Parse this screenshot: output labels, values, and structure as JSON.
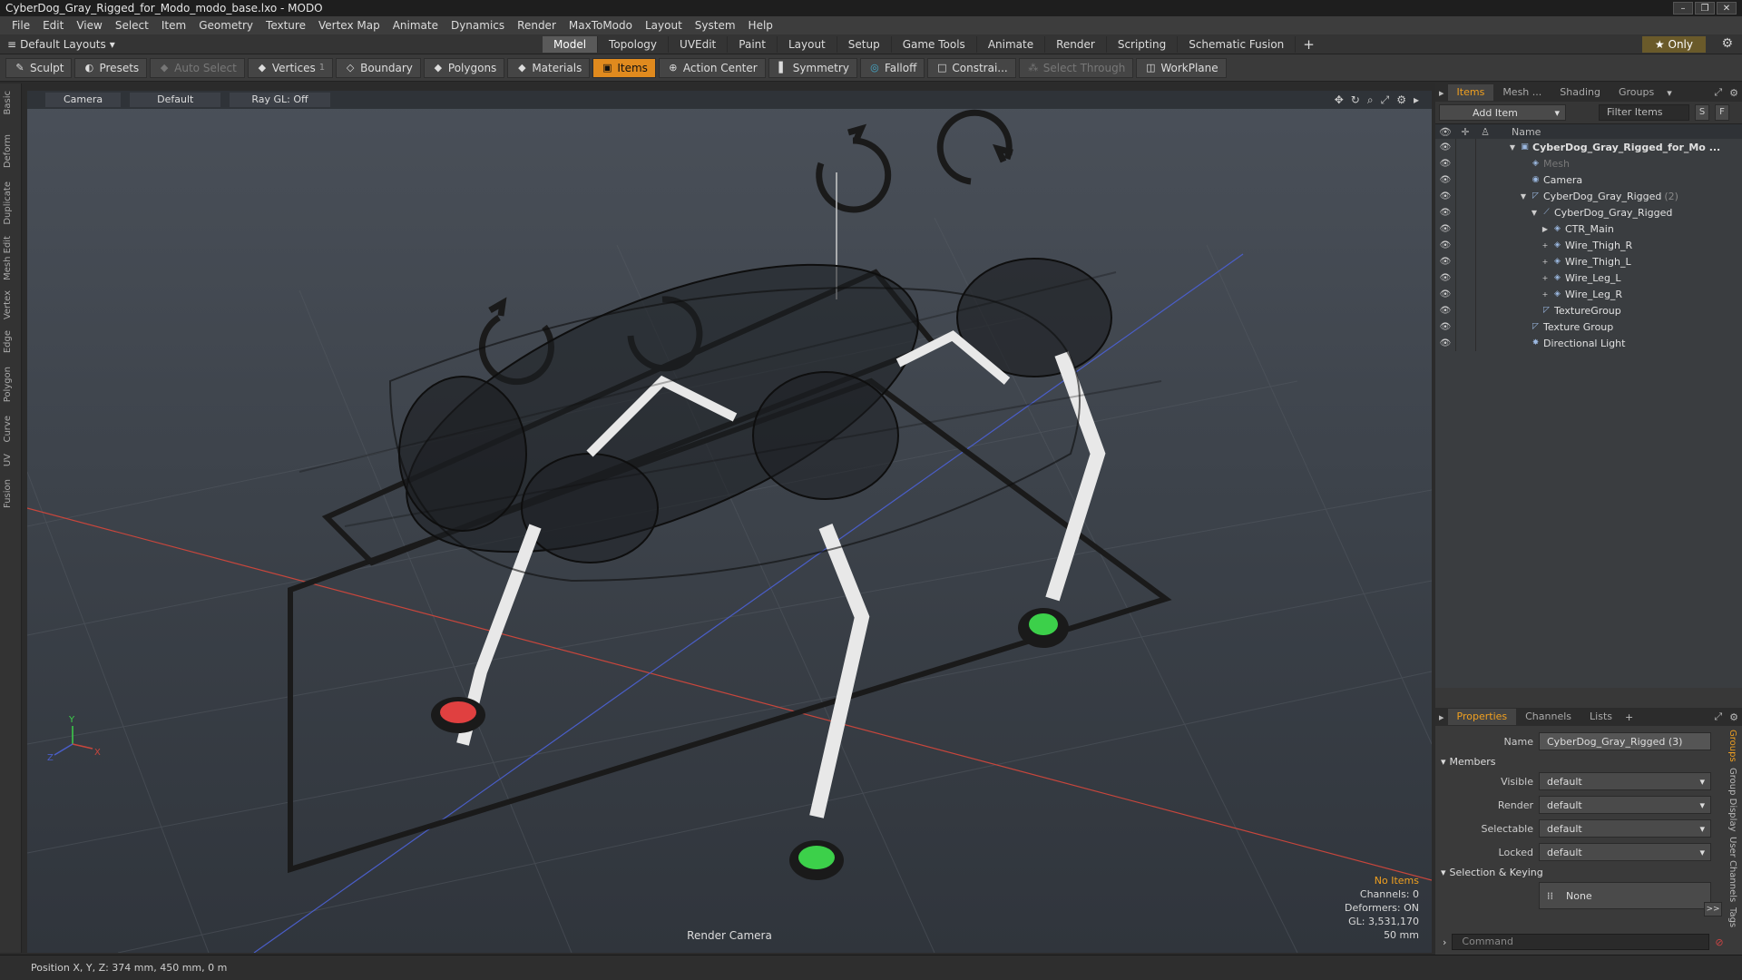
{
  "window": {
    "title": "CyberDog_Gray_Rigged_for_Modo_modo_base.lxo - MODO",
    "controls": [
      "–",
      "❐",
      "✕"
    ]
  },
  "menu": [
    "File",
    "Edit",
    "View",
    "Select",
    "Item",
    "Geometry",
    "Texture",
    "Vertex Map",
    "Animate",
    "Dynamics",
    "Render",
    "MaxToModo",
    "Layout",
    "System",
    "Help"
  ],
  "layout": {
    "default_layouts": "Default Layouts",
    "tabs": [
      "Model",
      "Topology",
      "UVEdit",
      "Paint",
      "Layout",
      "Setup",
      "Game Tools",
      "Animate",
      "Render",
      "Scripting",
      "Schematic Fusion"
    ],
    "active_tab": "Model",
    "only": "Only"
  },
  "toolbar": {
    "sculpt": "Sculpt",
    "presets": "Presets",
    "auto_select": "Auto Select",
    "vertices": "Vertices",
    "vertices_count": "1",
    "boundary": "Boundary",
    "polygons": "Polygons",
    "materials": "Materials",
    "items": "Items",
    "action_center": "Action Center",
    "symmetry": "Symmetry",
    "falloff": "Falloff",
    "constraints": "Constrai...",
    "select_through": "Select Through",
    "workplane": "WorkPlane"
  },
  "left_tabs": [
    "Basic",
    "Deform",
    "Duplicate",
    "Mesh Edit",
    "Vertex",
    "Edge",
    "Polygon",
    "Curve",
    "UV",
    "Fusion"
  ],
  "viewport": {
    "camera": "Camera",
    "shading": "Default",
    "raygl": "Ray GL: Off",
    "info": {
      "no_items": "No Items",
      "channels": "Channels: 0",
      "deformers": "Deformers: ON",
      "gl": "GL: 3,531,170",
      "focal": "50 mm"
    },
    "render_camera": "Render Camera",
    "axis": {
      "y": "Y",
      "x": "X",
      "z": "Z"
    }
  },
  "status": {
    "position": "Position X, Y, Z:  374 mm, 450 mm, 0 m"
  },
  "items_panel": {
    "tabs": [
      "Items",
      "Mesh ...",
      "Shading",
      "Groups"
    ],
    "active_tab": "Items",
    "add_item": "Add Item",
    "filter": "Filter Items",
    "s_btn": "S",
    "f_btn": "F",
    "column_name": "Name",
    "rows": [
      {
        "label": "CyberDog_Gray_Rigged_for_Mo ...",
        "indent": 0,
        "arrow": "▼",
        "icon": "▣",
        "bold": true
      },
      {
        "label": "Mesh",
        "indent": 1,
        "arrow": "",
        "icon": "◈",
        "dim": true
      },
      {
        "label": "Camera",
        "indent": 1,
        "arrow": "",
        "icon": "◉"
      },
      {
        "label": "CyberDog_Gray_Rigged",
        "count": "(2)",
        "indent": 1,
        "arrow": "▼",
        "icon": "◸"
      },
      {
        "label": "CyberDog_Gray_Rigged",
        "indent": 2,
        "arrow": "▼",
        "icon": "⟋"
      },
      {
        "label": "CTR_Main",
        "indent": 3,
        "arrow": "▶",
        "icon": "◈"
      },
      {
        "label": "Wire_Thigh_R",
        "indent": 3,
        "arrow": "+",
        "icon": "◈"
      },
      {
        "label": "Wire_Thigh_L",
        "indent": 3,
        "arrow": "+",
        "icon": "◈"
      },
      {
        "label": "Wire_Leg_L",
        "indent": 3,
        "arrow": "+",
        "icon": "◈"
      },
      {
        "label": "Wire_Leg_R",
        "indent": 3,
        "arrow": "+",
        "icon": "◈"
      },
      {
        "label": "TextureGroup",
        "indent": 2,
        "arrow": "",
        "icon": "◸"
      },
      {
        "label": "Texture Group",
        "indent": 1,
        "arrow": "",
        "icon": "◸"
      },
      {
        "label": "Directional Light",
        "indent": 1,
        "arrow": "",
        "icon": "✸"
      }
    ]
  },
  "properties_panel": {
    "tabs": [
      "Properties",
      "Channels",
      "Lists"
    ],
    "active_tab": "Properties",
    "name_label": "Name",
    "name_value": "CyberDog_Gray_Rigged (3)",
    "members": "Members",
    "fields": [
      {
        "label": "Visible",
        "value": "default"
      },
      {
        "label": "Render",
        "value": "default"
      },
      {
        "label": "Selectable",
        "value": "default"
      },
      {
        "label": "Locked",
        "value": "default"
      }
    ],
    "selection_keying": "Selection & Keying",
    "none": "None",
    "more": ">>",
    "side_tabs": [
      "Groups",
      "Group Display",
      "User Channels",
      "Tags"
    ]
  },
  "command": {
    "placeholder": "Command"
  },
  "colors": {
    "accent": "#e08a1e",
    "x_axis": "#c8463c",
    "z_axis": "#4a5ec8",
    "foot_red": "#e04040",
    "foot_green": "#3cd04a"
  }
}
